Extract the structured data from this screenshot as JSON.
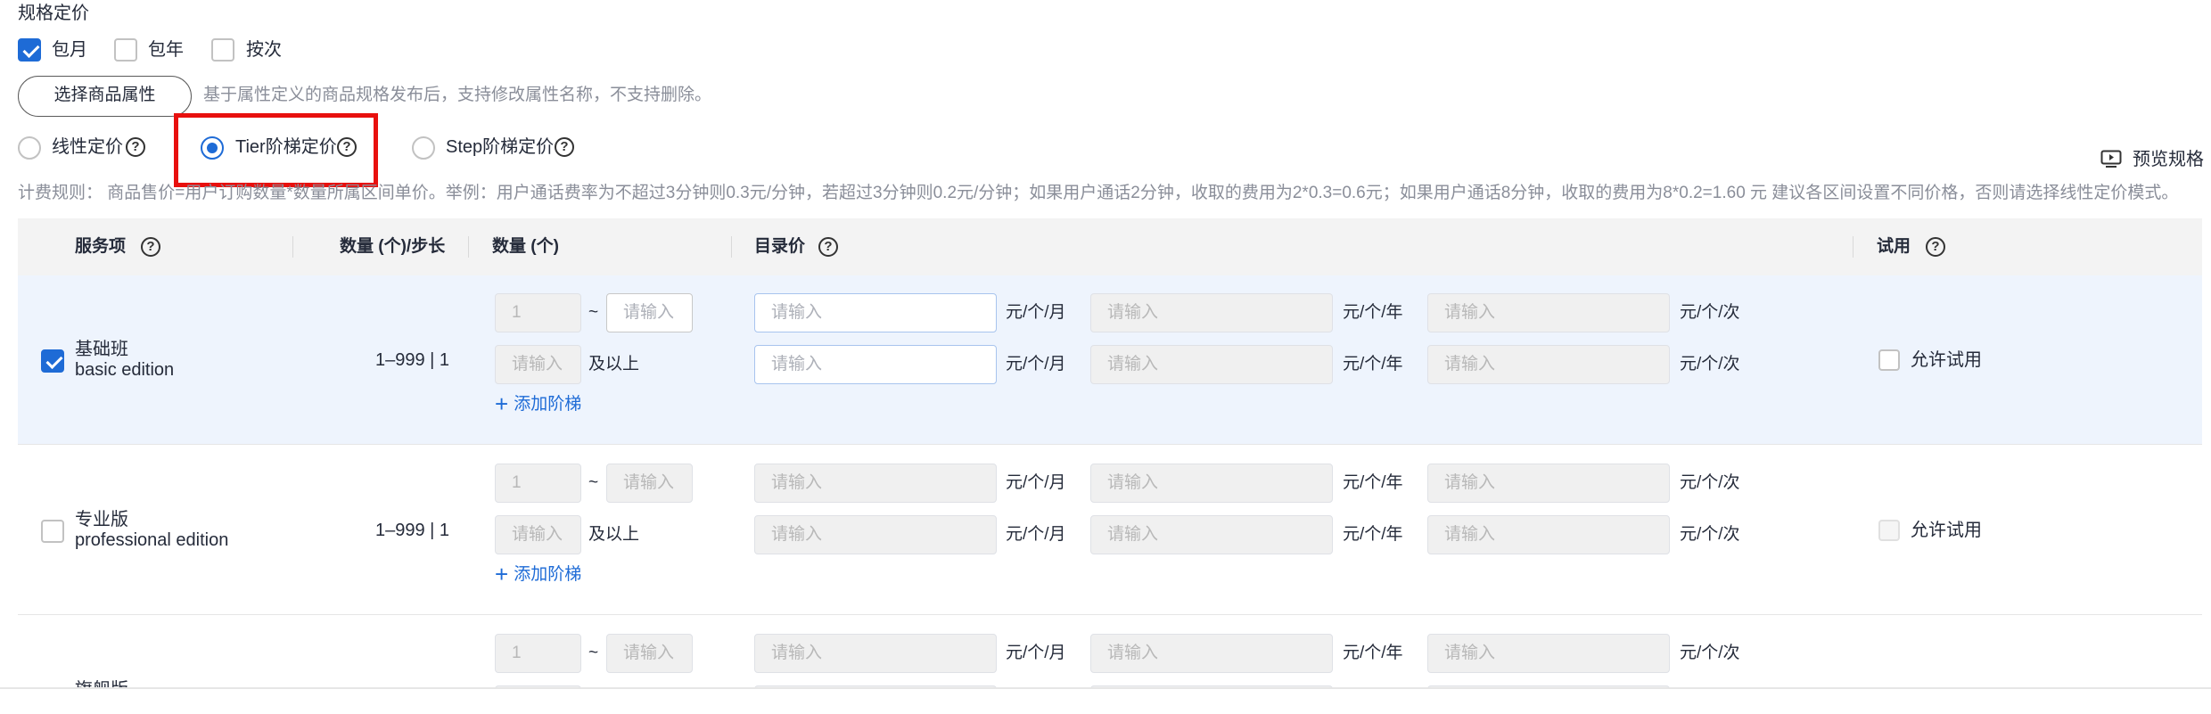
{
  "section_title": "规格定价",
  "billing_modes": [
    {
      "label": "包月",
      "checked": true
    },
    {
      "label": "包年",
      "checked": false
    },
    {
      "label": "按次",
      "checked": false
    }
  ],
  "select_attr_button": "选择商品属性",
  "select_attr_hint": "基于属性定义的商品规格发布后，支持修改属性名称，不支持删除。",
  "pricing_types": [
    {
      "label": "线性定价",
      "selected": false
    },
    {
      "label": "Tier阶梯定价",
      "selected": true
    },
    {
      "label": "Step阶梯定价",
      "selected": false
    }
  ],
  "preview_label": "预览规格",
  "billing_rule": "计费规则： 商品售价=用户订购数量*数量所属区间单价。举例：用户通话费率为不超过3分钟则0.3元/分钟，若超过3分钟则0.2元/分钟；如果用户通话2分钟，收取的费用为2*0.3=0.6元；如果用户通话8分钟，收取的费用为8*0.2=1.60 元 建议各区间设置不同价格，否则请选择线性定价模式。",
  "table": {
    "headers": {
      "service": "服务项",
      "qty_step": "数量 (个)/步长",
      "qty": "数量 (个)",
      "list_price": "目录价",
      "trial": "试用"
    },
    "placeholder": "请输入",
    "qty_first_value": "1",
    "tilde": "~",
    "and_above": "及以上",
    "units": [
      "元/个/月",
      "元/个/年",
      "元/个/次"
    ],
    "add_tier": "添加阶梯",
    "allow_trial": "允许试用",
    "rows": [
      {
        "name": "基础班",
        "name_en": "basic edition",
        "range": "1–999 | 1",
        "checked": true
      },
      {
        "name": "专业版",
        "name_en": "professional edition",
        "range": "1–999 | 1",
        "checked": false
      },
      {
        "name": "旗舰版",
        "name_en": "",
        "range": "",
        "checked": false
      }
    ]
  },
  "colors": {
    "accent": "#1e6bd6",
    "highlight_box": "#e8100e",
    "selected_row": "#eef4fd"
  }
}
